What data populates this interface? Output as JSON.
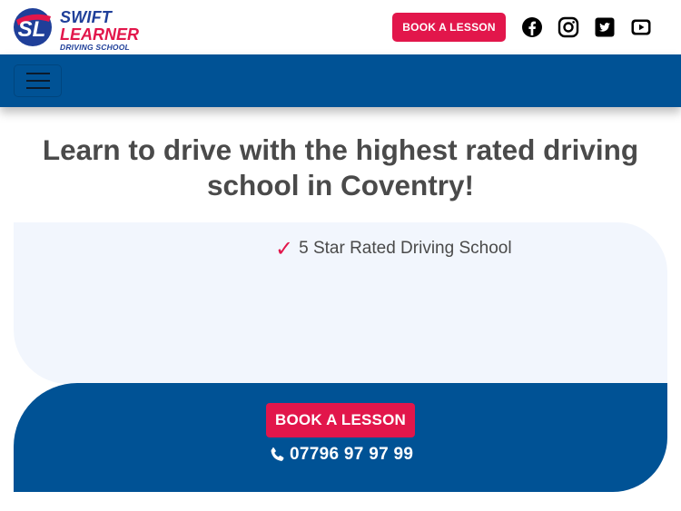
{
  "header": {
    "logo": {
      "line1": "SWIFT",
      "line2": "LEARNER",
      "line3": "DRIVING SCHOOL",
      "mark": "SL"
    },
    "book_button_label": "BOOK A LESSON",
    "social_icons": [
      "facebook-icon",
      "instagram-icon",
      "twitter-icon",
      "youtube-icon"
    ]
  },
  "navbar": {
    "menu_icon": "hamburger-menu-icon"
  },
  "hero": {
    "heading_line1": "Learn to drive with the highest rated driving",
    "heading_line2": "school in Coventry!"
  },
  "features": {
    "check_symbol": "✓",
    "items": [
      "5 Star Rated Driving School"
    ]
  },
  "cta": {
    "book_button_label": "BOOK A LESSON",
    "phone_icon": "phone-icon",
    "phone_number": "07796 97 97 99"
  },
  "colors": {
    "brand_blue": "#005295",
    "brand_pink": "#e2164b",
    "logo_blue": "#1f3f99",
    "panel_light": "#f2f6fd",
    "text_gray": "#4a4a4a"
  }
}
